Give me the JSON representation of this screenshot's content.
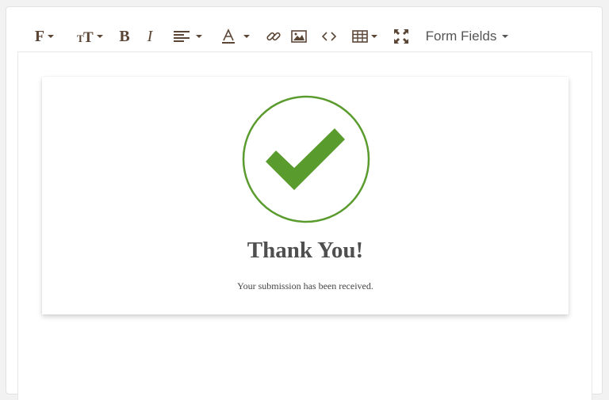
{
  "toolbar": {
    "font_family_icon": "F",
    "font_size_icon": "TT",
    "bold_icon": "B",
    "italic_icon": "I",
    "form_fields_label": "Form Fields"
  },
  "card": {
    "title": "Thank You!",
    "message": "Your submission has been received.",
    "icon": "checkmark-circle-icon",
    "accent_color": "#5a9b2e"
  },
  "colors": {
    "toolbar_icon": "#5b4636",
    "title_text": "#4f4f4f",
    "panel_border": "#e2e2e2"
  }
}
